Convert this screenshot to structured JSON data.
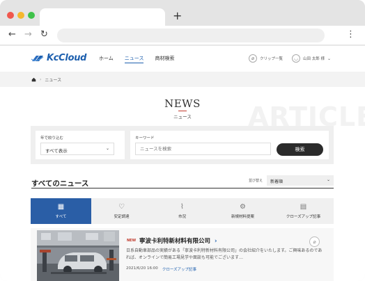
{
  "browser": {
    "new_tab_symbol": "+",
    "back_icon": "←",
    "forward_icon": "→",
    "reload_icon": "↻",
    "menu_icon": "⋮"
  },
  "header": {
    "logo_text": "KcCloud",
    "nav": [
      "ホーム",
      "ニュース",
      "商材検索"
    ],
    "clip_label": "クリップ一覧",
    "user_name": "山田 太郎 様"
  },
  "breadcrumb": {
    "current": "ニュース"
  },
  "hero": {
    "title": "NEWS",
    "subtitle": "ニュース",
    "bg_word": "ARTICLE"
  },
  "filter": {
    "year_label": "年で絞り込む",
    "year_value": "すべて表示",
    "keyword_label": "キーワード",
    "keyword_placeholder": "ニュースを検索",
    "search_button": "検索"
  },
  "list": {
    "section_title": "すべてのニュース",
    "sort_label": "並び替え",
    "sort_value": "新着順"
  },
  "categories": [
    {
      "label": "すべて",
      "icon": "▦"
    },
    {
      "label": "安定調達",
      "icon": "♡"
    },
    {
      "label": "市況",
      "icon": "⌇"
    },
    {
      "label": "新規材料提案",
      "icon": "⚙"
    },
    {
      "label": "クローズアップ記事",
      "icon": "▤"
    }
  ],
  "article": {
    "badge": "NEW",
    "title": "寧波卡利特新材料有限公司",
    "title_arrow": "›",
    "description": "日系自動車部品の実績がある「寧波卡利特新材料有限公司」の会社紹介をいたします。ご興味あるのであれば、オンラインで簡易工場見学や面談も可能でございます…",
    "date": "2021/6/20 16:00",
    "category": "クローズアップ記事"
  },
  "colors": {
    "accent": "#2a5ea6",
    "logo": "#1d5fae",
    "badge": "#c0392b"
  }
}
